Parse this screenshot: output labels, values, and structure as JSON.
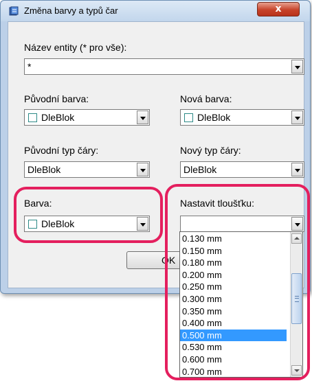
{
  "window": {
    "title": "Změna barvy a typů čar",
    "close_label": "x",
    "icon": "app-icon"
  },
  "entity": {
    "label": "Název entity (* pro vše):",
    "value": "*"
  },
  "original_color": {
    "label": "Původní barva:",
    "value": "DleBlok"
  },
  "new_color": {
    "label": "Nová barva:",
    "value": "DleBlok"
  },
  "original_linetype": {
    "label": "Původní typ čáry:",
    "value": "DleBlok"
  },
  "new_linetype": {
    "label": "Nový typ čáry:",
    "value": "DleBlok"
  },
  "color": {
    "label": "Barva:",
    "value": "DleBlok"
  },
  "thickness": {
    "label": "Nastavit tloušťku:",
    "value": "",
    "options": [
      "0.130 mm",
      "0.150 mm",
      "0.180 mm",
      "0.200 mm",
      "0.250 mm",
      "0.300 mm",
      "0.350 mm",
      "0.400 mm",
      "0.500 mm",
      "0.530 mm",
      "0.600 mm",
      "0.700 mm"
    ],
    "highlighted": "0.500 mm"
  },
  "ok_button": {
    "label": "OK"
  },
  "colors": {
    "highlight_ring": "#e41f5e",
    "selection": "#3399ff",
    "swatch_border": "#2c8a87",
    "close_button": "#c7432a"
  }
}
